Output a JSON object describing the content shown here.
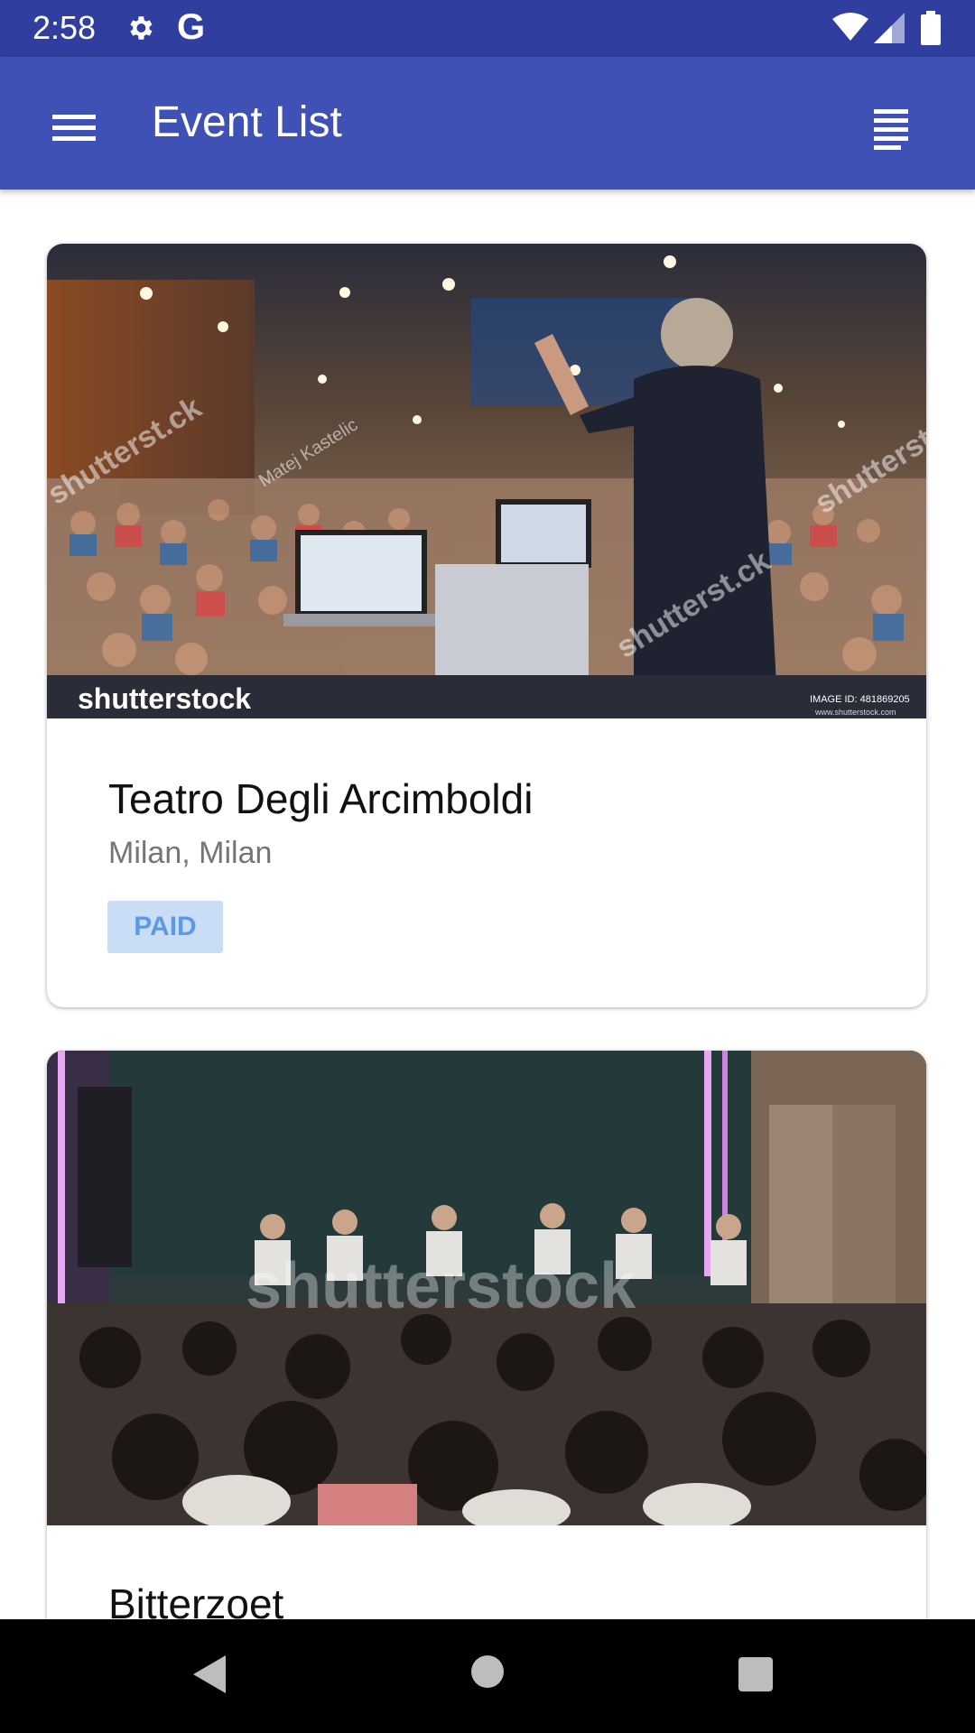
{
  "status_bar": {
    "time": "2:58",
    "g_label": "G",
    "icons": [
      "gear-icon",
      "google-icon",
      "wifi-icon",
      "signal-icon",
      "battery-icon"
    ]
  },
  "app_bar": {
    "title": "Event List",
    "left_icon": "menu-icon",
    "right_icon": "list-view-icon",
    "color": "#3f51b5"
  },
  "events": [
    {
      "title": "Teatro Degli Arcimboldi",
      "location": "Milan, Milan",
      "badge": "PAID",
      "image_watermark": "shutterstock",
      "image_id_label": "IMAGE ID: 481869205",
      "image_site": "www.shutterstock.com",
      "image_credit": "Matej Kastelic"
    },
    {
      "title": "Bitterzoet",
      "image_watermark": "shutterstock"
    }
  ],
  "colors": {
    "status_bar": "#303f9f",
    "badge_bg": "#c9ddf7",
    "badge_text": "#5d9ae3"
  }
}
